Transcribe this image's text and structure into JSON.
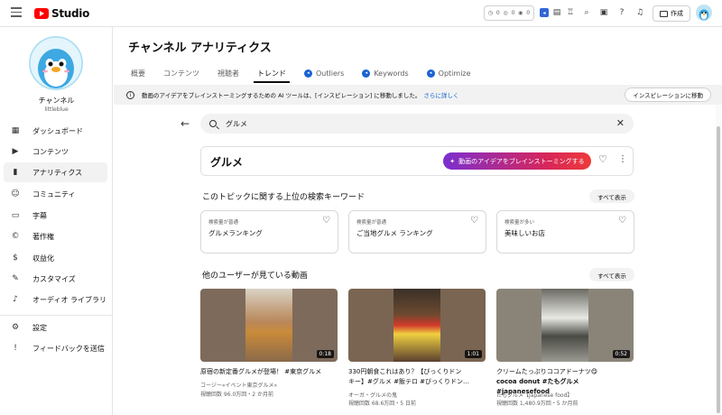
{
  "app": {
    "logo_text": "Studio"
  },
  "topbar": {
    "stats": [
      "0",
      "0",
      "0"
    ],
    "create_label": "作成",
    "icons": [
      "speech-icon",
      "news-icon",
      "trophy-icon",
      "search-icon",
      "feedback-icon",
      "help-icon",
      "bell-icon"
    ]
  },
  "sidebar": {
    "channel_name": "チャンネル",
    "channel_handle": "littleblue",
    "items": [
      {
        "label": "ダッシュボード",
        "icon": "dashboard-icon"
      },
      {
        "label": "コンテンツ",
        "icon": "content-icon"
      },
      {
        "label": "アナリティクス",
        "icon": "analytics-icon"
      },
      {
        "label": "コミュニティ",
        "icon": "community-icon"
      },
      {
        "label": "字幕",
        "icon": "subtitles-icon"
      },
      {
        "label": "著作権",
        "icon": "copyright-icon"
      },
      {
        "label": "収益化",
        "icon": "monetization-icon"
      },
      {
        "label": "カスタマイズ",
        "icon": "customize-icon"
      },
      {
        "label": "オーディオ ライブラリ",
        "icon": "audio-library-icon"
      }
    ],
    "bottom_items": [
      {
        "label": "設定",
        "icon": "settings-icon"
      },
      {
        "label": "フィードバックを送信",
        "icon": "feedback-icon"
      }
    ]
  },
  "page": {
    "title": "チャンネル アナリティクス"
  },
  "tabs": [
    {
      "label": "概要"
    },
    {
      "label": "コンテンツ"
    },
    {
      "label": "視聴者"
    },
    {
      "label": "トレンド"
    },
    {
      "label": "Outliers"
    },
    {
      "label": "Keywords"
    },
    {
      "label": "Optimize"
    }
  ],
  "banner": {
    "text": "動画のアイデアをブレインストーミングするための AI ツールは、[インスピレーション] に移動しました。",
    "link": "さらに詳しく",
    "button": "インスピレーションに移動"
  },
  "search": {
    "value": "グルメ"
  },
  "topic": {
    "title": "グルメ",
    "brainstorm_label": "動画のアイデアをブレインストーミングする"
  },
  "keywords_section": {
    "title": "このトピックに関する上位の検索キーワード",
    "show_all": "すべて表示",
    "cards": [
      {
        "volume": "検索量が普通",
        "keyword": "グルメランキング"
      },
      {
        "volume": "検索量が普通",
        "keyword": "ご当地グルメ ランキング"
      },
      {
        "volume": "検索量が多い",
        "keyword": "美味しいお店"
      }
    ]
  },
  "videos_section": {
    "title": "他のユーザーが見ている動画",
    "show_all": "すべて表示",
    "videos": [
      {
        "duration": "0:18",
        "title_line1": "原宿の新定番グルメが登場！ #東京グルメ",
        "title_line2": "",
        "channel": "コージー«イベント東京グルメ»",
        "meta": "視聴回数 96.0万回・2 か月前"
      },
      {
        "duration": "1:01",
        "title_line1": "330円朝食これはあり？【びっくりドン",
        "title_line2": "キー】#グルメ #飯テロ #びっくりドン…",
        "channel": "オーガ・グルメの鬼",
        "meta": "視聴回数 68.6万回・5 日前"
      },
      {
        "duration": "0:52",
        "title_line1": "クリームたっぷりココアドーナツ😋",
        "title_line2": "cocoa donut #たもグルメ #japanesefood",
        "channel": "たもグルメ【Japanese food】",
        "meta": "視聴回数 1,480.9万回・5 か月前"
      }
    ]
  },
  "colors": {
    "brand_red": "#ff0000",
    "link_blue": "#065fd4",
    "badge_blue": "#1c62d2"
  }
}
